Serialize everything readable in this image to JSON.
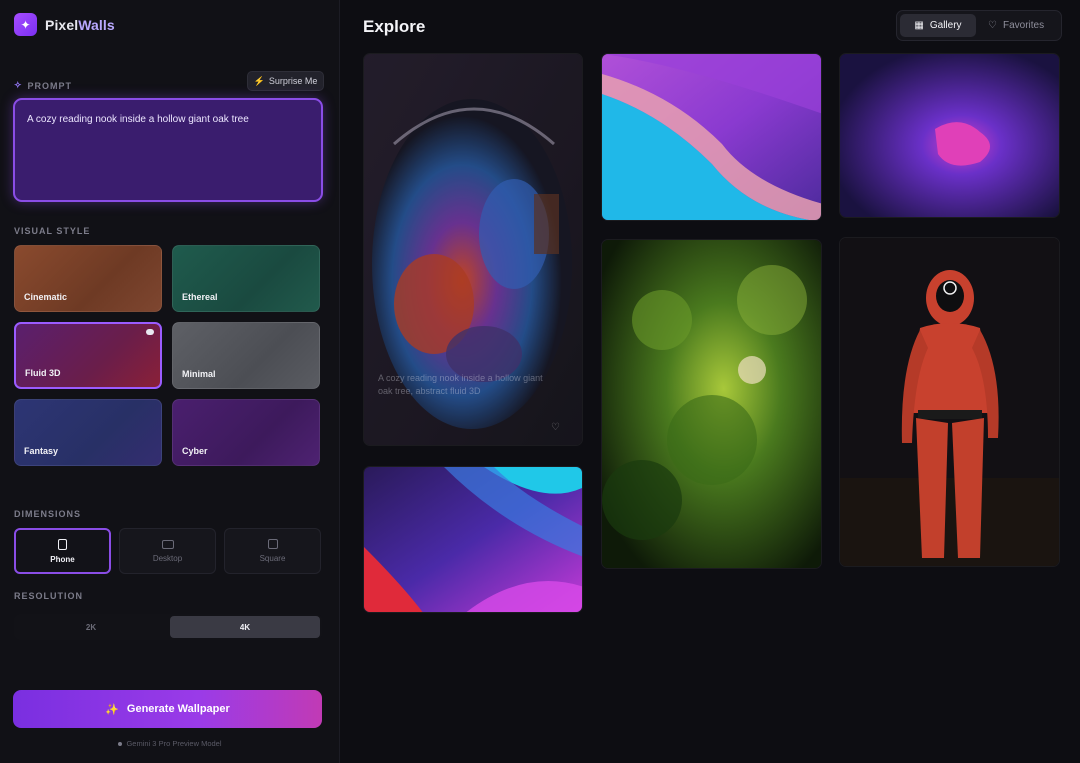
{
  "app": {
    "name_part1": "Pixel",
    "name_part2": "Walls",
    "logo_icon": "sparkle-icon"
  },
  "sidebar": {
    "prompt_label": "PROMPT",
    "surprise_label": "Surprise Me",
    "prompt_text": "A cozy reading nook inside a hollow giant oak tree",
    "visual_style_label": "VISUAL STYLE",
    "styles": [
      {
        "label": "Cinematic",
        "selected": false
      },
      {
        "label": "Ethereal",
        "selected": false
      },
      {
        "label": "Fluid 3D",
        "selected": true
      },
      {
        "label": "Minimal",
        "selected": false
      },
      {
        "label": "Fantasy",
        "selected": false
      },
      {
        "label": "Cyber",
        "selected": false
      }
    ],
    "dimensions_label": "DIMENSIONS",
    "dimensions": [
      {
        "label": "Phone",
        "active": true
      },
      {
        "label": "Desktop",
        "active": false
      },
      {
        "label": "Square",
        "active": false
      }
    ],
    "resolution_label": "RESOLUTION",
    "resolutions": [
      {
        "label": "2K",
        "active": false
      },
      {
        "label": "4K",
        "active": true
      }
    ],
    "generate_label": "Generate Wallpaper",
    "model_note": "Gemini 3 Pro Preview Model"
  },
  "main": {
    "title": "Explore",
    "view_tabs": [
      {
        "label": "Gallery",
        "icon": "grid-icon",
        "active": true
      },
      {
        "label": "Favorites",
        "icon": "heart-icon",
        "active": false
      }
    ],
    "gallery": [
      {
        "id": "reading-nook",
        "caption": "A cozy reading nook inside a hollow giant oak tree, abstract fluid 3D"
      },
      {
        "id": "purple-waves"
      },
      {
        "id": "purple-glow"
      },
      {
        "id": "forest"
      },
      {
        "id": "red-suit-figure"
      },
      {
        "id": "neon-gradient"
      }
    ]
  },
  "colors": {
    "accent": "#8a4de6",
    "background": "#0d0d12",
    "sidebar_bg": "#111116"
  }
}
